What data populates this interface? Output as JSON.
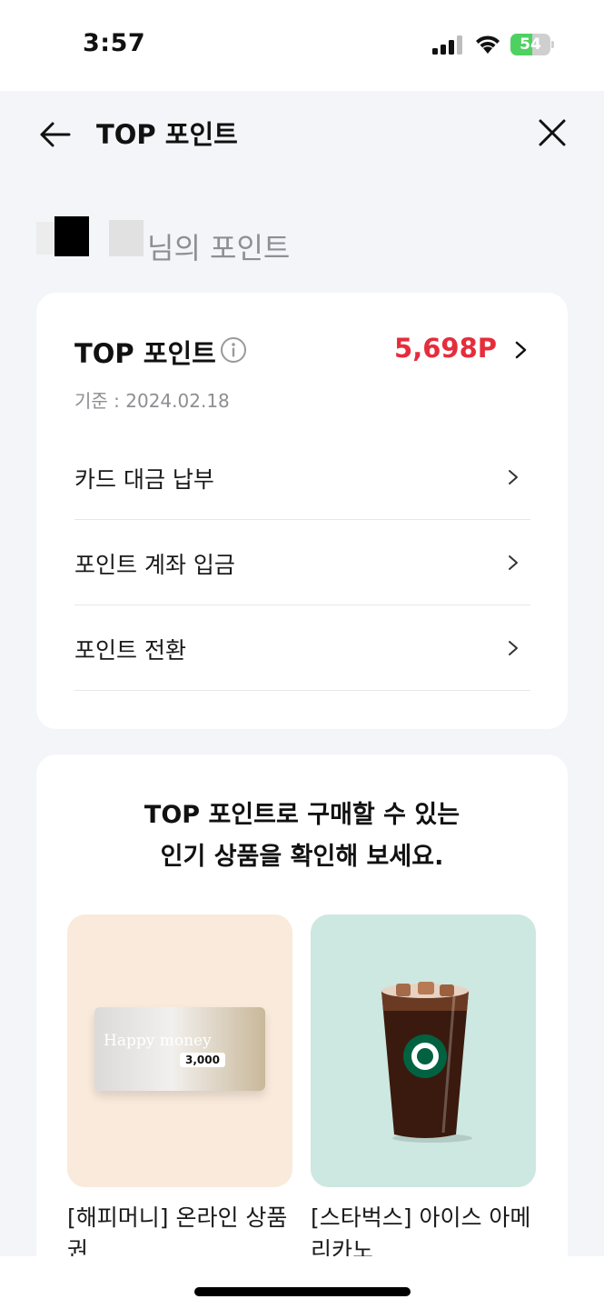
{
  "status_bar": {
    "time": "3:57",
    "battery": "54",
    "battery_level": 0.54
  },
  "nav": {
    "title": "TOP 포인트"
  },
  "owner": {
    "suffix": "님의 포인트"
  },
  "points_card": {
    "title": "TOP 포인트",
    "value": "5,698P",
    "date": "기준 : 2024.02.18",
    "menu": [
      {
        "label": "카드 대금 납부"
      },
      {
        "label": "포인트 계좌 입금"
      },
      {
        "label": "포인트 전환"
      }
    ]
  },
  "promo": {
    "title_line1": "TOP 포인트로 구매할 수 있는",
    "title_line2": "인기 상품을 확인해 보세요.",
    "products": [
      {
        "name": "[해피머니] 온라인 상품권",
        "bg": "#f9eadb",
        "voucher_text": "Happy money",
        "voucher_amount": "3,000"
      },
      {
        "name": "[스타벅스] 아이스 아메리카노",
        "bg": "#cde7e1"
      }
    ]
  },
  "colors": {
    "accent_red": "#e52d3c"
  }
}
